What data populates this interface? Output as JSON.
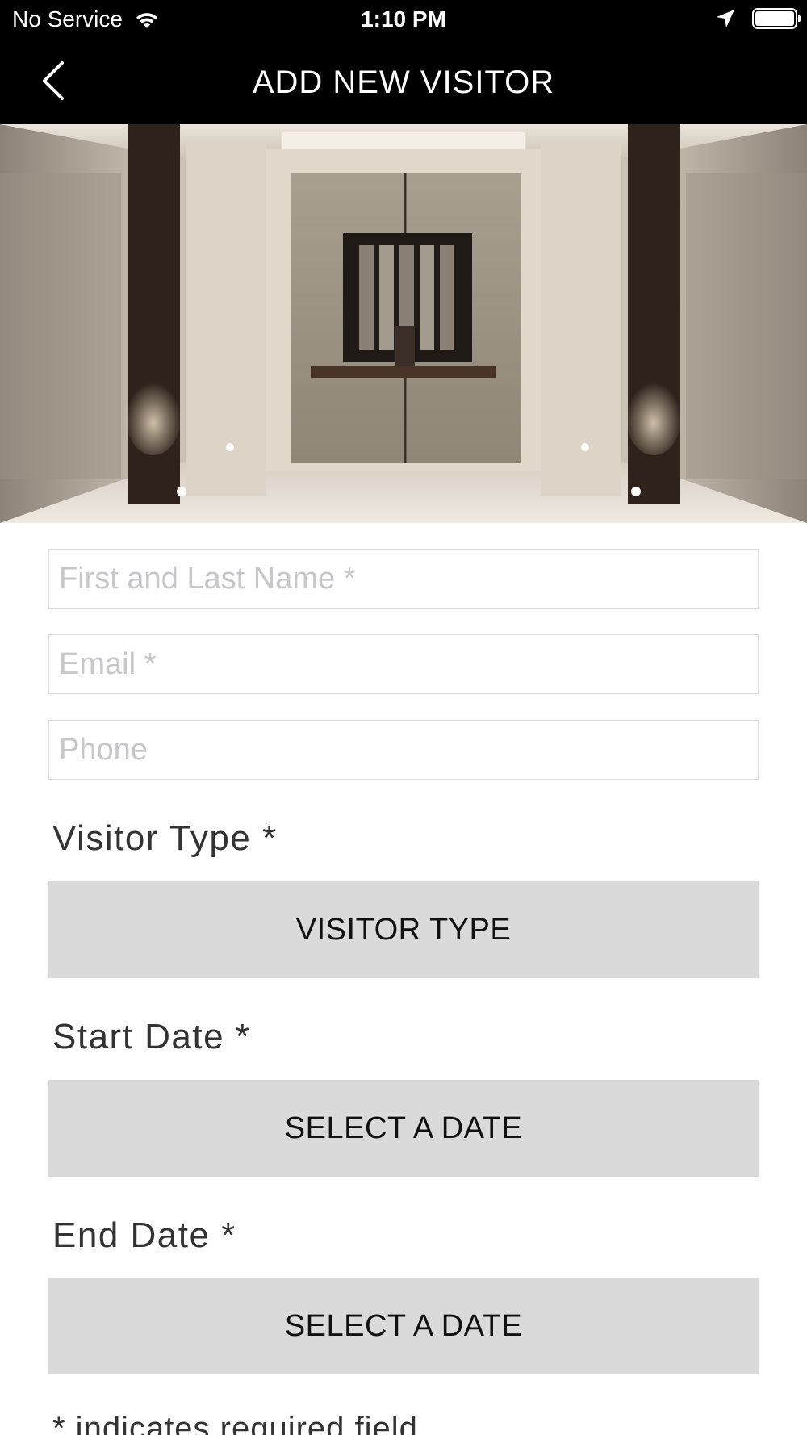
{
  "status_bar": {
    "carrier": "No Service",
    "time": "1:10 PM",
    "battery_level": 1.0
  },
  "nav": {
    "title": "ADD NEW VISITOR",
    "back_icon": "chevron-left-icon"
  },
  "form": {
    "name_placeholder": "First and Last Name *",
    "email_placeholder": "Email *",
    "phone_placeholder": "Phone",
    "visitor_type_label": "Visitor Type *",
    "visitor_type_button": "VISITOR TYPE",
    "start_date_label": "Start Date *",
    "start_date_button": "SELECT A DATE",
    "end_date_label": "End Date *",
    "end_date_button": "SELECT A DATE",
    "required_note": "* indicates required field"
  }
}
